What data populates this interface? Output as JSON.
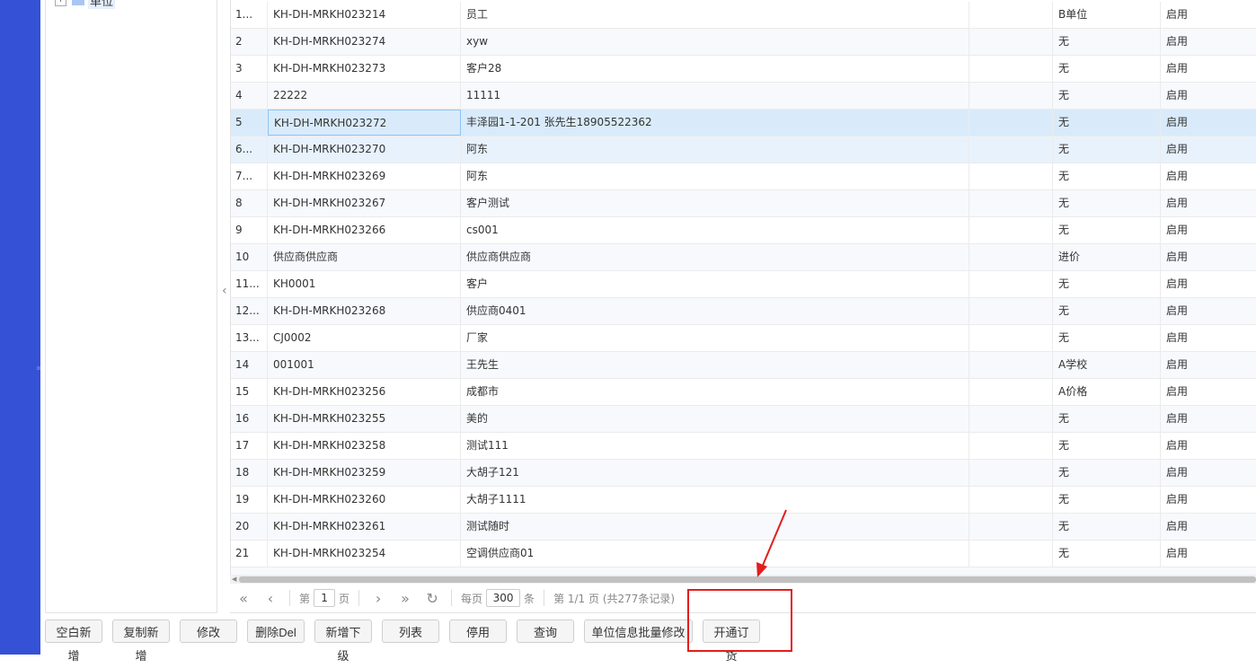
{
  "tree": {
    "toggle": "+",
    "root_label": "单位"
  },
  "collapse_handle": "‹",
  "rows": [
    {
      "no": "1...",
      "code": "KH-DH-MRKH023214",
      "name": "员工",
      "extra": "",
      "price": "B单位",
      "status": "启用"
    },
    {
      "no": "2",
      "code": "KH-DH-MRKH023274",
      "name": "xyw",
      "extra": "",
      "price": "无",
      "status": "启用"
    },
    {
      "no": "3",
      "code": "KH-DH-MRKH023273",
      "name": "客户28",
      "extra": "",
      "price": "无",
      "status": "启用"
    },
    {
      "no": "4",
      "code": "22222",
      "name": "11111",
      "extra": "",
      "price": "无",
      "status": "启用"
    },
    {
      "no": "5",
      "code": "KH-DH-MRKH023272",
      "name": "丰泽园1-1-201 张先生18905522362",
      "extra": "",
      "price": "无",
      "status": "启用"
    },
    {
      "no": "6...",
      "code": "KH-DH-MRKH023270",
      "name": "阿东",
      "extra": "",
      "price": "无",
      "status": "启用"
    },
    {
      "no": "7...",
      "code": "KH-DH-MRKH023269",
      "name": "阿东",
      "extra": "",
      "price": "无",
      "status": "启用"
    },
    {
      "no": "8",
      "code": "KH-DH-MRKH023267",
      "name": "客户测试",
      "extra": "",
      "price": "无",
      "status": "启用"
    },
    {
      "no": "9",
      "code": "KH-DH-MRKH023266",
      "name": "cs001",
      "extra": "",
      "price": "无",
      "status": "启用"
    },
    {
      "no": "10",
      "code": "供应商供应商",
      "name": "供应商供应商",
      "extra": "",
      "price": "进价",
      "status": "启用"
    },
    {
      "no": "11...",
      "code": "KH0001",
      "name": "客户",
      "extra": "",
      "price": "无",
      "status": "启用"
    },
    {
      "no": "12...",
      "code": "KH-DH-MRKH023268",
      "name": "供应商0401",
      "extra": "",
      "price": "无",
      "status": "启用"
    },
    {
      "no": "13...",
      "code": "CJ0002",
      "name": "厂家",
      "extra": "",
      "price": "无",
      "status": "启用"
    },
    {
      "no": "14",
      "code": "001001",
      "name": "王先生",
      "extra": "",
      "price": "A学校",
      "status": "启用"
    },
    {
      "no": "15",
      "code": "KH-DH-MRKH023256",
      "name": "成都市",
      "extra": "",
      "price": "A价格",
      "status": "启用"
    },
    {
      "no": "16",
      "code": "KH-DH-MRKH023255",
      "name": "美的",
      "extra": "",
      "price": "无",
      "status": "启用"
    },
    {
      "no": "17",
      "code": "KH-DH-MRKH023258",
      "name": "测试111",
      "extra": "",
      "price": "无",
      "status": "启用"
    },
    {
      "no": "18",
      "code": "KH-DH-MRKH023259",
      "name": "大胡子121",
      "extra": "",
      "price": "无",
      "status": "启用"
    },
    {
      "no": "19",
      "code": "KH-DH-MRKH023260",
      "name": "大胡子1111",
      "extra": "",
      "price": "无",
      "status": "启用"
    },
    {
      "no": "20",
      "code": "KH-DH-MRKH023261",
      "name": "测试随时",
      "extra": "",
      "price": "无",
      "status": "启用"
    },
    {
      "no": "21",
      "code": "KH-DH-MRKH023254",
      "name": "空调供应商01",
      "extra": "",
      "price": "无",
      "status": "启用"
    }
  ],
  "pager": {
    "first": "«",
    "prev": "‹",
    "next": "›",
    "last": "»",
    "refresh": "↻",
    "page_prefix": "第",
    "page_value": "1",
    "page_suffix": "页",
    "per_page_label": "每页",
    "per_page_value": "300",
    "per_page_unit": "条",
    "summary": "第 1/1 页 (共277条记录)"
  },
  "toolbar": {
    "buttons": [
      "空白新增",
      "复制新增",
      "修改",
      "删除Del",
      "新增下级",
      "列表",
      "停用",
      "查询",
      "单位信息批量修改",
      "开通订货"
    ]
  },
  "annotation": {
    "color": "#e51c1c"
  }
}
